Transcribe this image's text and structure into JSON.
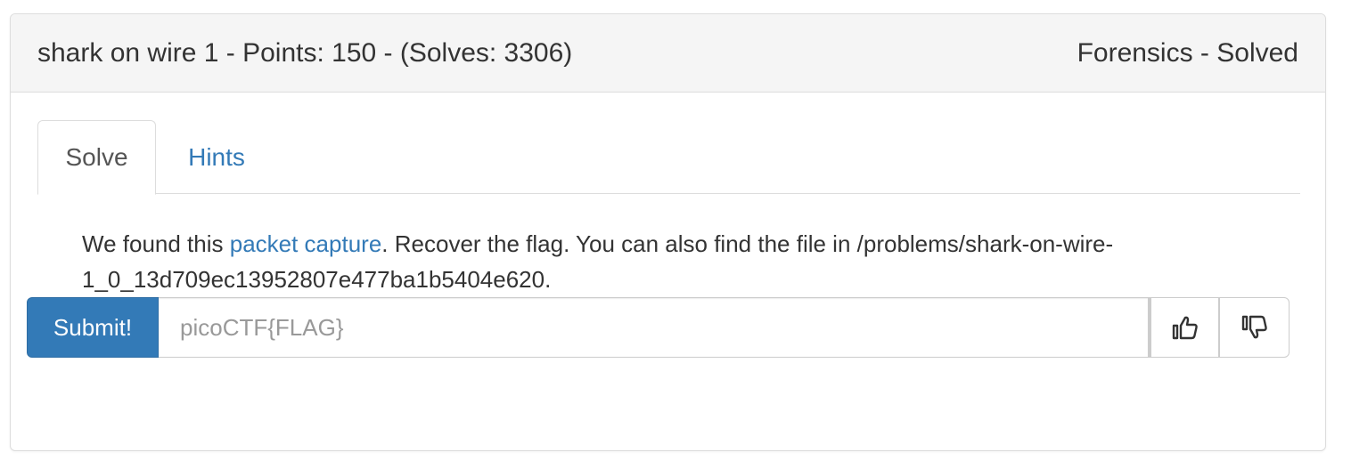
{
  "header": {
    "title": "shark on wire 1 - Points: 150 - (Solves: 3306)",
    "status": "Forensics - Solved"
  },
  "tabs": [
    {
      "label": "Solve",
      "active": true
    },
    {
      "label": "Hints",
      "active": false
    }
  ],
  "description": {
    "prefix": "We found this ",
    "link_text": "packet capture",
    "suffix": ". Recover the flag. You can also find the file in /problems/shark-on-wire-1_0_13d709ec13952807e477ba1b5404e620."
  },
  "form": {
    "submit_label": "Submit!",
    "placeholder": "picoCTF{FLAG}",
    "value": ""
  },
  "icons": {
    "upvote": "thumbs-up-icon",
    "downvote": "thumbs-down-icon"
  },
  "colors": {
    "link": "#337ab7",
    "button": "#337ab7",
    "heading_bg": "#f5f5f5"
  }
}
